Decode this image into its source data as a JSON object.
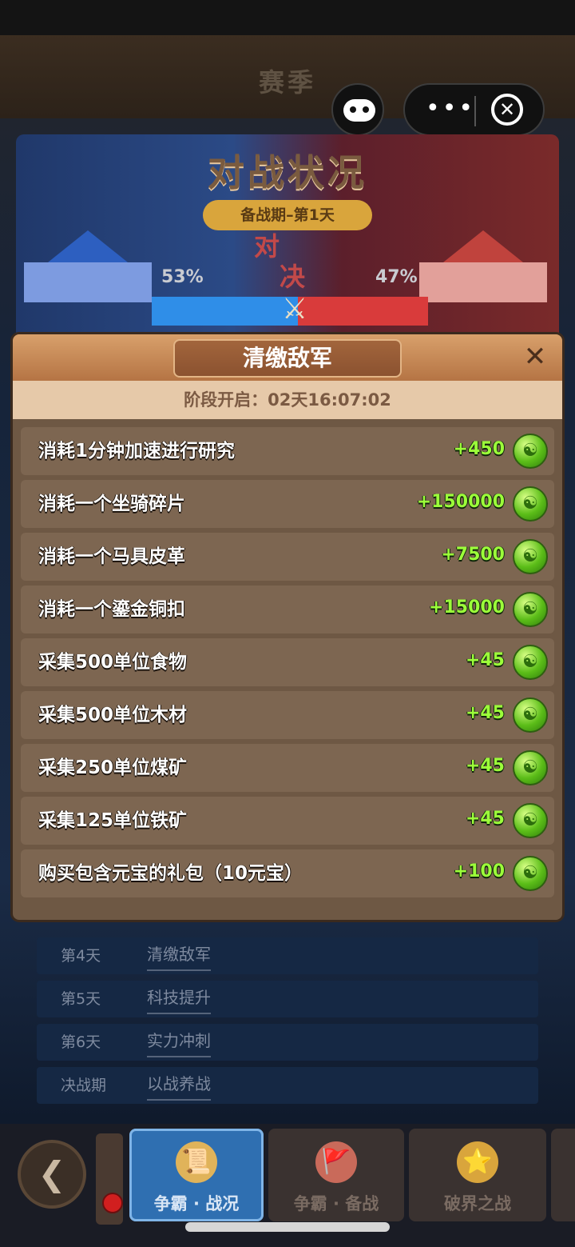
{
  "header": {
    "season_title": "赛季"
  },
  "capsule": {
    "menu_dots": "•••",
    "close_glyph": "✕"
  },
  "battle": {
    "title": "对战状况",
    "phase": "备战期–第1天",
    "vs_top": "对",
    "vs_bottom": "决",
    "blue_percent_label": "53%",
    "red_percent_label": "47%",
    "blue_share": 0.53,
    "red_share": 0.47,
    "colors": {
      "blue": "#2f8ee8",
      "red": "#d93b3b"
    }
  },
  "modal": {
    "title": "清缴敌军",
    "close_glyph": "✕",
    "phase_open": "阶段开启：02天16:07:02",
    "tasks": [
      {
        "label": "消耗1分钟加速进行研究",
        "points": "+450"
      },
      {
        "label": "消耗一个坐骑碎片",
        "points": "+150000"
      },
      {
        "label": "消耗一个马具皮革",
        "points": "+7500"
      },
      {
        "label": "消耗一个鎏金铜扣",
        "points": "+15000"
      },
      {
        "label": "采集500单位食物",
        "points": "+45"
      },
      {
        "label": "采集500单位木材",
        "points": "+45"
      },
      {
        "label": "采集250单位煤矿",
        "points": "+45"
      },
      {
        "label": "采集125单位铁矿",
        "points": "+45"
      },
      {
        "label": "购买包含元宝的礼包（10元宝）",
        "points": "+100"
      }
    ],
    "point_icon": "jade-dragon-icon"
  },
  "schedule": [
    {
      "day": "第4天",
      "name": "清缴敌军"
    },
    {
      "day": "第5天",
      "name": "科技提升"
    },
    {
      "day": "第6天",
      "name": "实力冲刺"
    },
    {
      "day": "决战期",
      "name": "以战养战"
    }
  ],
  "bottom_nav": {
    "back_glyph": "❮",
    "tabs": [
      {
        "label": "争霸 · 战况",
        "icon": "scroll-icon",
        "active": true
      },
      {
        "label": "争霸 · 备战",
        "icon": "banner-icon",
        "active": false
      },
      {
        "label": "破界之战",
        "icon": "medal-icon",
        "active": false
      }
    ]
  }
}
